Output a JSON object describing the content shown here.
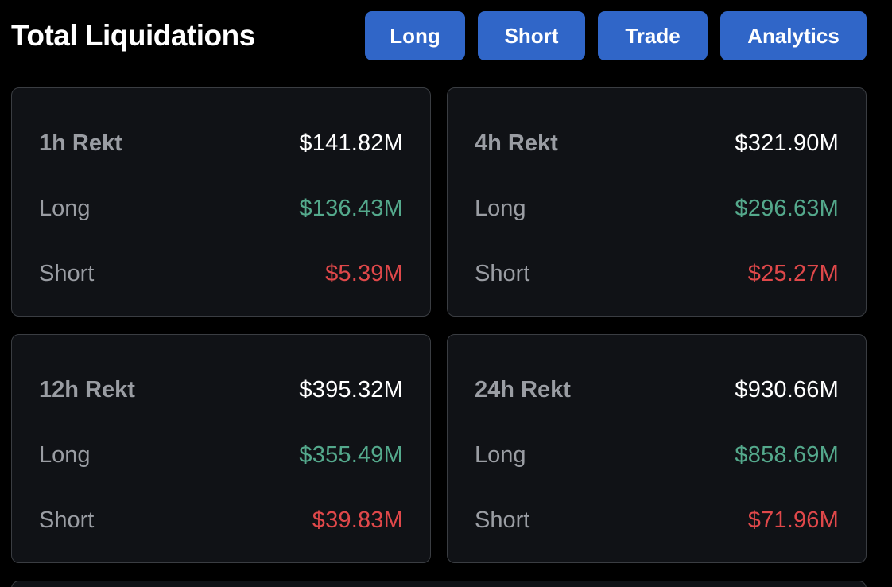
{
  "title": "Total Liquidations",
  "nav": {
    "long": "Long",
    "short": "Short",
    "trade": "Trade",
    "analytics": "Analytics"
  },
  "colors": {
    "button": "#3066c8",
    "long_value": "#54a98c",
    "short_value": "#e0484a",
    "card_bg": "#101216",
    "card_border": "#3a3d42"
  },
  "cards": [
    {
      "period_label": "1h Rekt",
      "total": "$141.82M",
      "long_label": "Long",
      "long_value": "$136.43M",
      "short_label": "Short",
      "short_value": "$5.39M"
    },
    {
      "period_label": "4h Rekt",
      "total": "$321.90M",
      "long_label": "Long",
      "long_value": "$296.63M",
      "short_label": "Short",
      "short_value": "$25.27M"
    },
    {
      "period_label": "12h Rekt",
      "total": "$395.32M",
      "long_label": "Long",
      "long_value": "$355.49M",
      "short_label": "Short",
      "short_value": "$39.83M"
    },
    {
      "period_label": "24h Rekt",
      "total": "$930.66M",
      "long_label": "Long",
      "long_value": "$858.69M",
      "short_label": "Short",
      "short_value": "$71.96M"
    }
  ]
}
